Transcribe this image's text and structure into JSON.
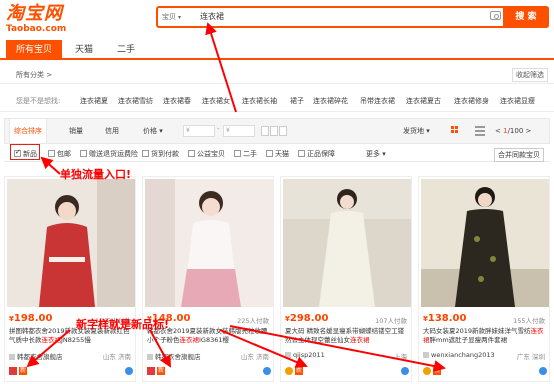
{
  "header": {
    "logo_cn": "淘宝网",
    "logo_en": "Taobao.com",
    "search_scope": "宝贝",
    "search_value": "连衣裙",
    "search_button": "搜 索"
  },
  "tabs": [
    "所有宝贝",
    "天猫",
    "二手"
  ],
  "category": {
    "all": "所有分类 >",
    "filter": "收起筛选"
  },
  "suggest": {
    "label": "您是不是想找:",
    "items": [
      "连衣裙夏",
      "连衣裙雪纺",
      "连衣裙春",
      "连衣裙女",
      "连衣裙长袖",
      "裙子",
      "连衣裙碎花",
      "吊带连衣裙",
      "连衣裙夏古",
      "连衣裙修身",
      "连衣裙显瘦"
    ]
  },
  "sortbar": {
    "items": [
      "综合排序",
      "销量",
      "信用",
      "价格"
    ],
    "price_from": "¥",
    "price_to": "¥",
    "ship_from": "发货地",
    "page_current": "1",
    "page_total": "/100"
  },
  "checkrow": {
    "items": [
      "新品",
      "包邮",
      "赠送退货运费险",
      "货到付款",
      "公益宝贝",
      "二手",
      "天猫",
      "正品保障"
    ],
    "more": "更多",
    "all_network": "合并同款宝贝"
  },
  "annotations": {
    "entry": "单独流量入口!",
    "new_product": "新字样就是新品标!"
  },
  "products": [
    {
      "price": "198.00",
      "paid": "1863人付款",
      "title_pre": "拼图韩都衣舍2019新款女装夏装新款红色气质中长款",
      "title_hl": "连衣裙",
      "title_post": "JN8255慢",
      "shop": "韩都衣舍旗舰店",
      "loc": "山东 济南",
      "img_bg": "#e9e2da",
      "img_fg": "#c43b3b"
    },
    {
      "price": "148.00",
      "paid": "225人付款",
      "title_pre": "韩都衣舍2019夏装新款女装韩版亮粒收腰小个子粉色",
      "title_hl": "连衣裙",
      "title_post": "IG8361樱",
      "shop": "韩都衣舍旗舰店",
      "loc": "山东 济南",
      "img_bg": "#f1e9e6",
      "img_fg": "#e7a8b3"
    },
    {
      "price": "298.00",
      "paid": "107人付款",
      "title_pre": "夏大码 精致名媛显瘦系带蝴蝶结镂空工镂然公主体现空蕾丝仙女",
      "title_hl": "连衣裙",
      "title_post": "",
      "shop": "qiisp2011",
      "loc": "上海",
      "img_bg": "#d9d3c8",
      "img_fg": "#f2efe6"
    },
    {
      "price": "138.00",
      "paid": "155人付款",
      "title_pre": "大码女装夏2019新款胖妹妹洋气雪纺",
      "title_hl": "连衣裙",
      "title_post": "胖mm遮肚子显瘦两件套裙",
      "shop": "wenxianchang2013",
      "loc": "广东 深圳",
      "img_bg": "#e8e3d4",
      "img_fg": "#2d2a22"
    }
  ],
  "colors": {
    "brand": "#ff5000",
    "annotation": "#ff0000"
  }
}
